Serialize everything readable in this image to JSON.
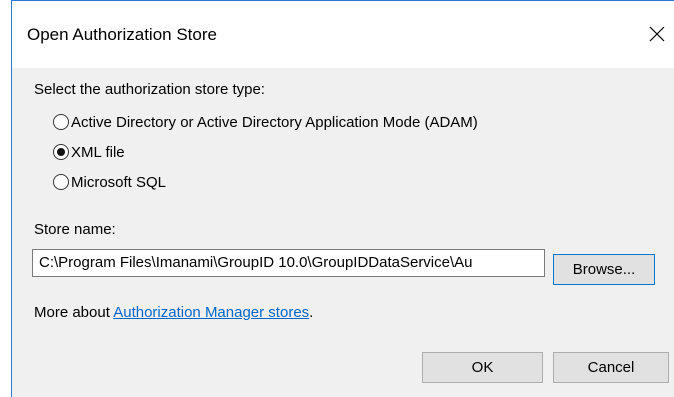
{
  "dialog": {
    "title": "Open Authorization Store",
    "close_icon": "close-icon"
  },
  "store_type": {
    "label": "Select the authorization store type:",
    "options": [
      {
        "label": "Active Directory or Active Directory Application Mode (ADAM)",
        "checked": false
      },
      {
        "label": "XML file",
        "checked": true
      },
      {
        "label": "Microsoft SQL",
        "checked": false
      }
    ]
  },
  "store_name": {
    "label": "Store name:",
    "value": "C:\\Program Files\\Imanami\\GroupID 10.0\\GroupIDDataService\\Au",
    "browse_label": "Browse..."
  },
  "more_about": {
    "prefix": "More about ",
    "link_text": "Authorization Manager stores",
    "suffix": "."
  },
  "footer": {
    "ok_label": "OK",
    "cancel_label": "Cancel"
  },
  "colors": {
    "accent": "#0078d7",
    "link": "#0066cc",
    "dialog_bg": "#f0f0f0"
  }
}
